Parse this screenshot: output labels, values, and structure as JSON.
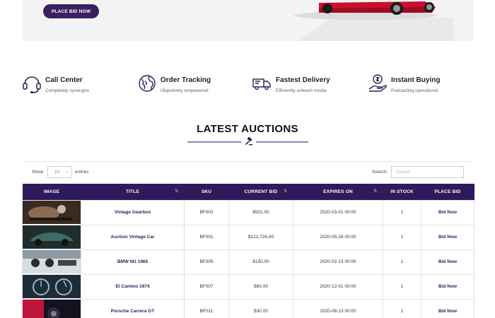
{
  "hero": {
    "button_label": "PLACE BID NOW"
  },
  "features": [
    {
      "title": "Call Center",
      "subtitle": "Completely synergize",
      "icon": "headset-icon"
    },
    {
      "title": "Order Tracking",
      "subtitle": "Objectively empowered",
      "icon": "globe-icon"
    },
    {
      "title": "Fastest Delivery",
      "subtitle": "Efficiently unleash media",
      "icon": "truck-icon"
    },
    {
      "title": "Instant Buying",
      "subtitle": "Podcasting operational",
      "icon": "money-hand-icon"
    }
  ],
  "section": {
    "title": "LATEST AUCTIONS",
    "icon": "gavel-icon"
  },
  "controls": {
    "show_label": "Show",
    "entries_value": "10",
    "entries_label": "entries",
    "search_label": "Search:",
    "search_placeholder": "Search"
  },
  "table": {
    "headers": [
      "IMAGE",
      "TITLE",
      "SKU",
      "CURRENT BID",
      "EXPIRES ON",
      "IN STOCK",
      "PLACE BID"
    ],
    "rows": [
      {
        "title": "Vintage Gearbox",
        "sku": "BF002",
        "bid": "$501.00",
        "expires": "2020-03-01 00:00",
        "stock": "1",
        "action": "Bid Now"
      },
      {
        "title": "Auction Vintage Car",
        "sku": "BF001",
        "bid": "$121,726.00",
        "expires": "2020-05-28 00:00",
        "stock": "1",
        "action": "Bid Now"
      },
      {
        "title": "BMW M1 1965",
        "sku": "BF005",
        "bid": "$150.00",
        "expires": "2020-02-13 00:00",
        "stock": "1",
        "action": "Bid Now"
      },
      {
        "title": "El Camino 1974",
        "sku": "BF007",
        "bid": "$60.00",
        "expires": "2020-12-01 00:00",
        "stock": "1",
        "action": "Bid Now"
      },
      {
        "title": "Porsche Carrera GT",
        "sku": "BF011",
        "bid": "$30.00",
        "expires": "2020-08-13 00:00",
        "stock": "1",
        "action": "Bid Now"
      }
    ]
  },
  "colors": {
    "brand": "#2e1b5b",
    "accent_line": "#8a86b5"
  }
}
